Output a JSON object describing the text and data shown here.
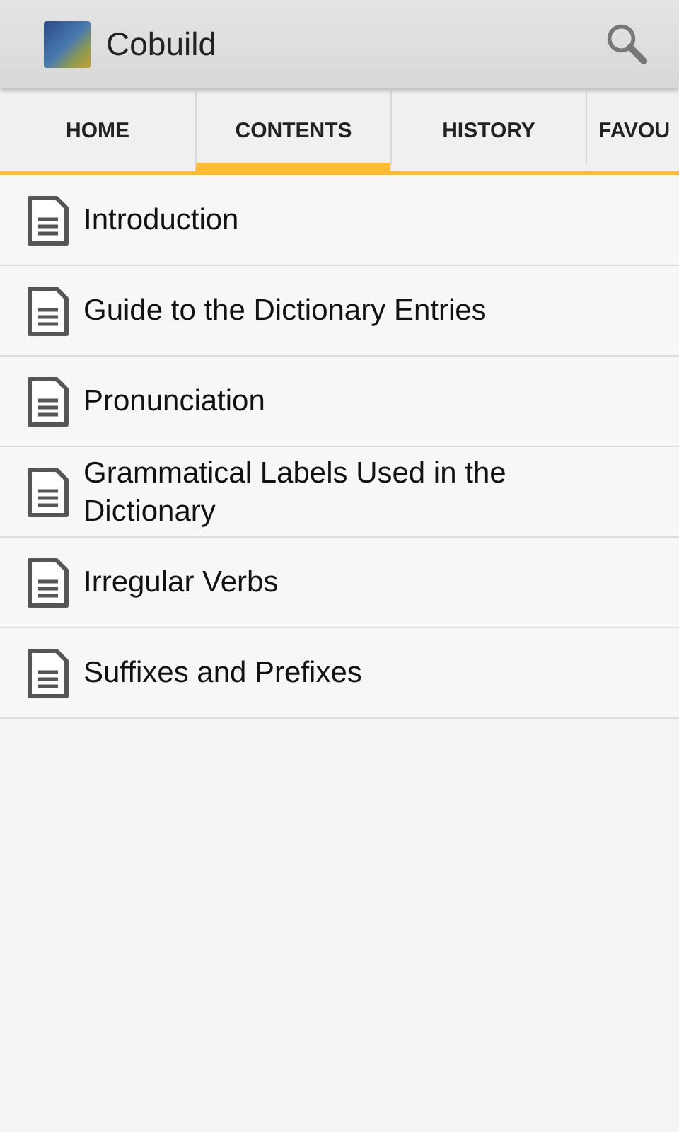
{
  "action_bar": {
    "title": "Cobuild"
  },
  "tabs": [
    {
      "label": "HOME",
      "selected": false
    },
    {
      "label": "CONTENTS",
      "selected": true
    },
    {
      "label": "HISTORY",
      "selected": false
    },
    {
      "label": "FAVOU",
      "selected": false
    }
  ],
  "contents": [
    {
      "title": "Introduction"
    },
    {
      "title": "Guide to the Dictionary Entries"
    },
    {
      "title": "Pronunciation"
    },
    {
      "title": "Grammatical Labels Used in the Dictionary"
    },
    {
      "title": "Irregular Verbs"
    },
    {
      "title": "Suffixes and Prefixes"
    }
  ]
}
